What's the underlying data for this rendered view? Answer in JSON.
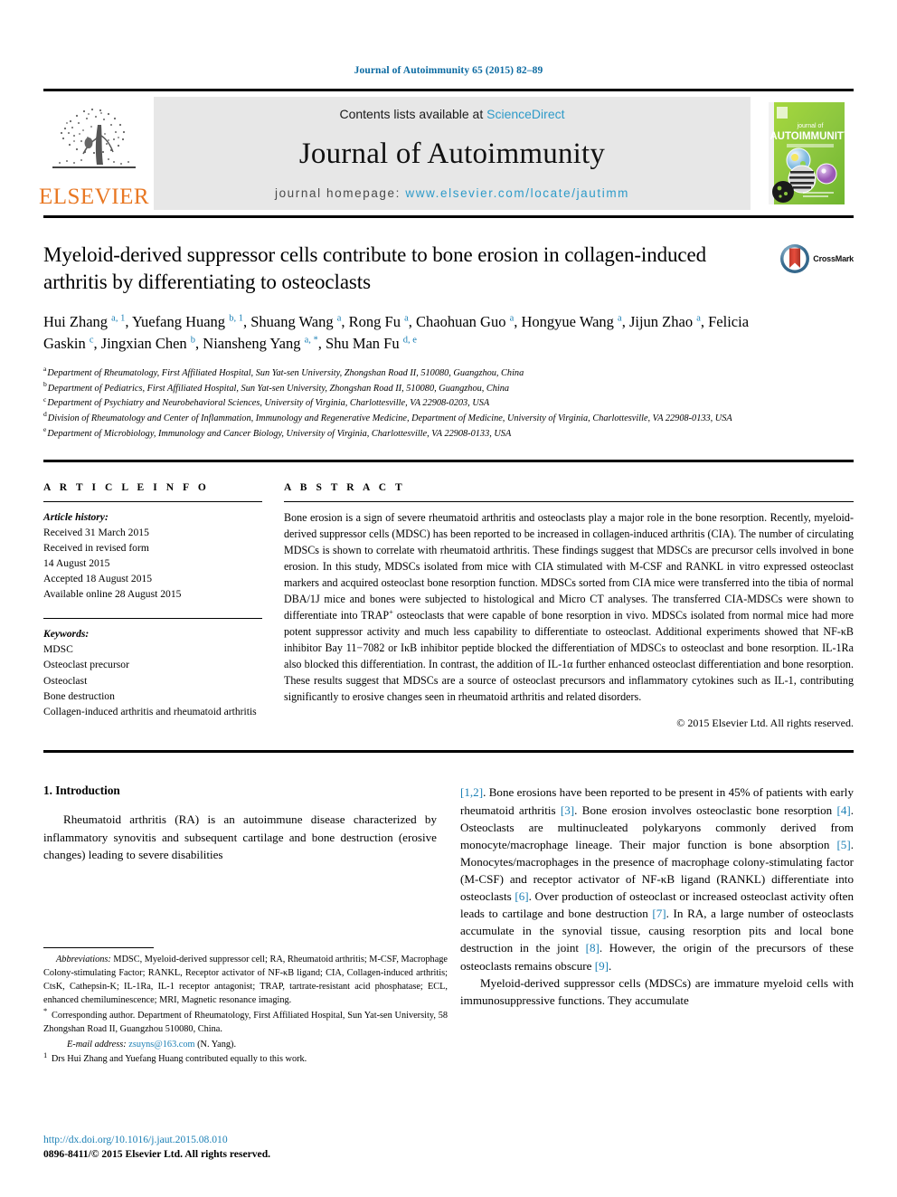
{
  "running_head": "Journal of Autoimmunity 65 (2015) 82–89",
  "masthead": {
    "elsevier_wordmark": "ELSEVIER",
    "contents_prefix": "Contents lists available at ",
    "contents_link": "ScienceDirect",
    "journal_title": "Journal of Autoimmunity",
    "homepage_prefix": "journal homepage: ",
    "homepage_url": "www.elsevier.com/locate/jautimm",
    "cover_line1": "journal of",
    "cover_line2": "AUTOIMMUNITY"
  },
  "article": {
    "title": "Myeloid-derived suppressor cells contribute to bone erosion in collagen-induced arthritis by differentiating to osteoclasts",
    "crossmark_label": "CrossMark",
    "authors_html": "Hui Zhang <sup>a, 1</sup>, Yuefang Huang <sup>b, 1</sup>, Shuang Wang <sup>a</sup>, Rong Fu <sup>a</sup>, Chaohuan Guo <sup>a</sup>, Hongyue Wang <sup>a</sup>, Jijun Zhao <sup>a</sup>, Felicia Gaskin <sup>c</sup>, Jingxian Chen <sup>b</sup>, Niansheng Yang <sup>a, *</sup>, Shu Man Fu <sup>d, e</sup>",
    "affiliations": [
      {
        "mark": "a",
        "text": "Department of Rheumatology, First Affiliated Hospital, Sun Yat-sen University, Zhongshan Road II, 510080, Guangzhou, China"
      },
      {
        "mark": "b",
        "text": "Department of Pediatrics, First Affiliated Hospital, Sun Yat-sen University, Zhongshan Road II, 510080, Guangzhou, China"
      },
      {
        "mark": "c",
        "text": "Department of Psychiatry and Neurobehavioral Sciences, University of Virginia, Charlottesville, VA 22908-0203, USA"
      },
      {
        "mark": "d",
        "text": "Division of Rheumatology and Center of Inflammation, Immunology and Regenerative Medicine, Department of Medicine, University of Virginia, Charlottesville, VA 22908-0133, USA"
      },
      {
        "mark": "e",
        "text": "Department of Microbiology, Immunology and Cancer Biology, University of Virginia, Charlottesville, VA 22908-0133, USA"
      }
    ]
  },
  "article_info": {
    "heading": "A R T I C L E   I N F O",
    "history_label": "Article history:",
    "history": [
      "Received 31 March 2015",
      "Received in revised form",
      "14 August 2015",
      "Accepted 18 August 2015",
      "Available online 28 August 2015"
    ],
    "keywords_label": "Keywords:",
    "keywords": [
      "MDSC",
      "Osteoclast precursor",
      "Osteoclast",
      "Bone destruction",
      "Collagen-induced arthritis and rheumatoid arthritis"
    ]
  },
  "abstract": {
    "heading": "A B S T R A C T",
    "text_html": "Bone erosion is a sign of severe rheumatoid arthritis and osteoclasts play a major role in the bone resorption. Recently, myeloid-derived suppressor cells (MDSC) has been reported to be increased in collagen-induced arthritis (CIA). The number of circulating MDSCs is shown to correlate with rheumatoid arthritis. These findings suggest that MDSCs are precursor cells involved in bone erosion. In this study, MDSCs isolated from mice with CIA stimulated with M-CSF and RANKL in vitro expressed osteoclast markers and acquired osteoclast bone resorption function. MDSCs sorted from CIA mice were transferred into the tibia of normal DBA/1J mice and bones were subjected to histological and Micro CT analyses. The transferred CIA-MDSCs were shown to differentiate into TRAP<sup>+</sup> osteoclasts that were capable of bone resorption in vivo. MDSCs isolated from normal mice had more potent suppressor activity and much less capability to differentiate to osteoclast. Additional experiments showed that NF-κB inhibitor Bay 11−7082 or IκB inhibitor peptide blocked the differentiation of MDSCs to osteoclast and bone resorption. IL-1Ra also blocked this differentiation. In contrast, the addition of IL-1α further enhanced osteoclast differentiation and bone resorption. These results suggest that MDSCs are a source of osteoclast precursors and inflammatory cytokines such as IL-1, contributing significantly to erosive changes seen in rheumatoid arthritis and related disorders.",
    "copyright": "© 2015 Elsevier Ltd. All rights reserved."
  },
  "introduction": {
    "section_title": "1. Introduction",
    "left_para_html": "Rheumatoid arthritis (RA) is an autoimmune disease characterized by inflammatory synovitis and subsequent cartilage and bone destruction (erosive changes) leading to severe disabilities",
    "right_para1_html": "<span class=\"ref\">[1,2]</span>. Bone erosions have been reported to be present in 45% of patients with early rheumatoid arthritis <span class=\"ref\">[3]</span>. Bone erosion involves osteoclastic bone resorption <span class=\"ref\">[4]</span>. Osteoclasts are multinucleated polykaryons commonly derived from monocyte/macrophage lineage. Their major function is bone absorption <span class=\"ref\">[5]</span>. Monocytes/macrophages in the presence of macrophage colony-stimulating factor (M-CSF) and receptor activator of NF-κB ligand (RANKL) differentiate into osteoclasts <span class=\"ref\">[6]</span>. Over production of osteoclast or increased osteoclast activity often leads to cartilage and bone destruction <span class=\"ref\">[7]</span>. In RA, a large number of osteoclasts accumulate in the synovial tissue, causing resorption pits and local bone destruction in the joint <span class=\"ref\">[8]</span>. However, the origin of the precursors of these osteoclasts remains obscure <span class=\"ref\">[9]</span>.",
    "right_para2_html": "Myeloid-derived suppressor cells (MDSCs) are immature myeloid cells with immunosuppressive functions. They accumulate"
  },
  "footnotes": {
    "abbreviations_label": "Abbreviations:",
    "abbreviations_text": " MDSC, Myeloid-derived suppressor cell; RA, Rheumatoid arthritis; M-CSF, Macrophage Colony-stimulating Factor; RANKL, Receptor activator of NF-κB ligand; CIA, Collagen-induced arthritis; CtsK, Cathepsin-K; IL-1Ra, IL-1 receptor antagonist; TRAP, tartrate-resistant acid phosphatase; ECL, enhanced chemiluminescence; MRI, Magnetic resonance imaging.",
    "corresponding_mark": "*",
    "corresponding_text": " Corresponding author. Department of Rheumatology, First Affiliated Hospital, Sun Yat-sen University, 58 Zhongshan Road II, Guangzhou 510080, China.",
    "email_label": "E-mail address:",
    "email_address": "zsuyns@163.com",
    "email_suffix": " (N. Yang).",
    "equal_mark": "1",
    "equal_text": " Drs Hui Zhang and Yuefang Huang contributed equally to this work.",
    "doi": "http://dx.doi.org/10.1016/j.jaut.2015.08.010",
    "issn_line": "0896-8411/© 2015 Elsevier Ltd. All rights reserved."
  },
  "colors": {
    "link": "#1a7fb5",
    "sciencedirect": "#2e9bc9",
    "elsevier_orange": "#E87722",
    "cover_green": "#8cc63f"
  }
}
